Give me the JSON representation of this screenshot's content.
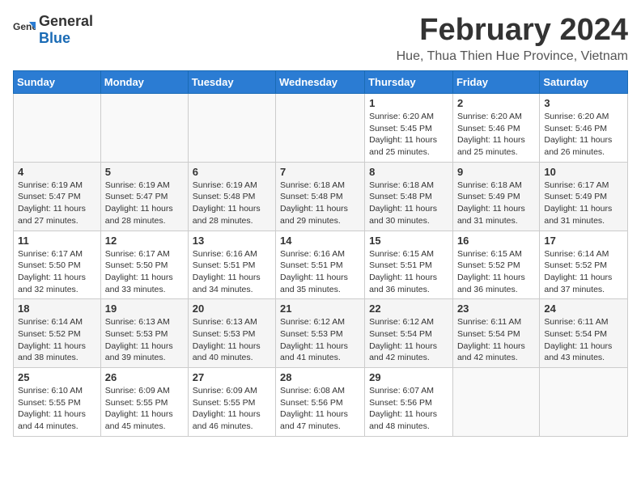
{
  "header": {
    "logo": {
      "text_general": "General",
      "text_blue": "Blue"
    },
    "title": "February 2024",
    "location": "Hue, Thua Thien Hue Province, Vietnam"
  },
  "weekdays": [
    "Sunday",
    "Monday",
    "Tuesday",
    "Wednesday",
    "Thursday",
    "Friday",
    "Saturday"
  ],
  "weeks": [
    [
      {
        "day": "",
        "info": ""
      },
      {
        "day": "",
        "info": ""
      },
      {
        "day": "",
        "info": ""
      },
      {
        "day": "",
        "info": ""
      },
      {
        "day": "1",
        "info": "Sunrise: 6:20 AM\nSunset: 5:45 PM\nDaylight: 11 hours and 25 minutes."
      },
      {
        "day": "2",
        "info": "Sunrise: 6:20 AM\nSunset: 5:46 PM\nDaylight: 11 hours and 25 minutes."
      },
      {
        "day": "3",
        "info": "Sunrise: 6:20 AM\nSunset: 5:46 PM\nDaylight: 11 hours and 26 minutes."
      }
    ],
    [
      {
        "day": "4",
        "info": "Sunrise: 6:19 AM\nSunset: 5:47 PM\nDaylight: 11 hours and 27 minutes."
      },
      {
        "day": "5",
        "info": "Sunrise: 6:19 AM\nSunset: 5:47 PM\nDaylight: 11 hours and 28 minutes."
      },
      {
        "day": "6",
        "info": "Sunrise: 6:19 AM\nSunset: 5:48 PM\nDaylight: 11 hours and 28 minutes."
      },
      {
        "day": "7",
        "info": "Sunrise: 6:18 AM\nSunset: 5:48 PM\nDaylight: 11 hours and 29 minutes."
      },
      {
        "day": "8",
        "info": "Sunrise: 6:18 AM\nSunset: 5:48 PM\nDaylight: 11 hours and 30 minutes."
      },
      {
        "day": "9",
        "info": "Sunrise: 6:18 AM\nSunset: 5:49 PM\nDaylight: 11 hours and 31 minutes."
      },
      {
        "day": "10",
        "info": "Sunrise: 6:17 AM\nSunset: 5:49 PM\nDaylight: 11 hours and 31 minutes."
      }
    ],
    [
      {
        "day": "11",
        "info": "Sunrise: 6:17 AM\nSunset: 5:50 PM\nDaylight: 11 hours and 32 minutes."
      },
      {
        "day": "12",
        "info": "Sunrise: 6:17 AM\nSunset: 5:50 PM\nDaylight: 11 hours and 33 minutes."
      },
      {
        "day": "13",
        "info": "Sunrise: 6:16 AM\nSunset: 5:51 PM\nDaylight: 11 hours and 34 minutes."
      },
      {
        "day": "14",
        "info": "Sunrise: 6:16 AM\nSunset: 5:51 PM\nDaylight: 11 hours and 35 minutes."
      },
      {
        "day": "15",
        "info": "Sunrise: 6:15 AM\nSunset: 5:51 PM\nDaylight: 11 hours and 36 minutes."
      },
      {
        "day": "16",
        "info": "Sunrise: 6:15 AM\nSunset: 5:52 PM\nDaylight: 11 hours and 36 minutes."
      },
      {
        "day": "17",
        "info": "Sunrise: 6:14 AM\nSunset: 5:52 PM\nDaylight: 11 hours and 37 minutes."
      }
    ],
    [
      {
        "day": "18",
        "info": "Sunrise: 6:14 AM\nSunset: 5:52 PM\nDaylight: 11 hours and 38 minutes."
      },
      {
        "day": "19",
        "info": "Sunrise: 6:13 AM\nSunset: 5:53 PM\nDaylight: 11 hours and 39 minutes."
      },
      {
        "day": "20",
        "info": "Sunrise: 6:13 AM\nSunset: 5:53 PM\nDaylight: 11 hours and 40 minutes."
      },
      {
        "day": "21",
        "info": "Sunrise: 6:12 AM\nSunset: 5:53 PM\nDaylight: 11 hours and 41 minutes."
      },
      {
        "day": "22",
        "info": "Sunrise: 6:12 AM\nSunset: 5:54 PM\nDaylight: 11 hours and 42 minutes."
      },
      {
        "day": "23",
        "info": "Sunrise: 6:11 AM\nSunset: 5:54 PM\nDaylight: 11 hours and 42 minutes."
      },
      {
        "day": "24",
        "info": "Sunrise: 6:11 AM\nSunset: 5:54 PM\nDaylight: 11 hours and 43 minutes."
      }
    ],
    [
      {
        "day": "25",
        "info": "Sunrise: 6:10 AM\nSunset: 5:55 PM\nDaylight: 11 hours and 44 minutes."
      },
      {
        "day": "26",
        "info": "Sunrise: 6:09 AM\nSunset: 5:55 PM\nDaylight: 11 hours and 45 minutes."
      },
      {
        "day": "27",
        "info": "Sunrise: 6:09 AM\nSunset: 5:55 PM\nDaylight: 11 hours and 46 minutes."
      },
      {
        "day": "28",
        "info": "Sunrise: 6:08 AM\nSunset: 5:56 PM\nDaylight: 11 hours and 47 minutes."
      },
      {
        "day": "29",
        "info": "Sunrise: 6:07 AM\nSunset: 5:56 PM\nDaylight: 11 hours and 48 minutes."
      },
      {
        "day": "",
        "info": ""
      },
      {
        "day": "",
        "info": ""
      }
    ]
  ]
}
